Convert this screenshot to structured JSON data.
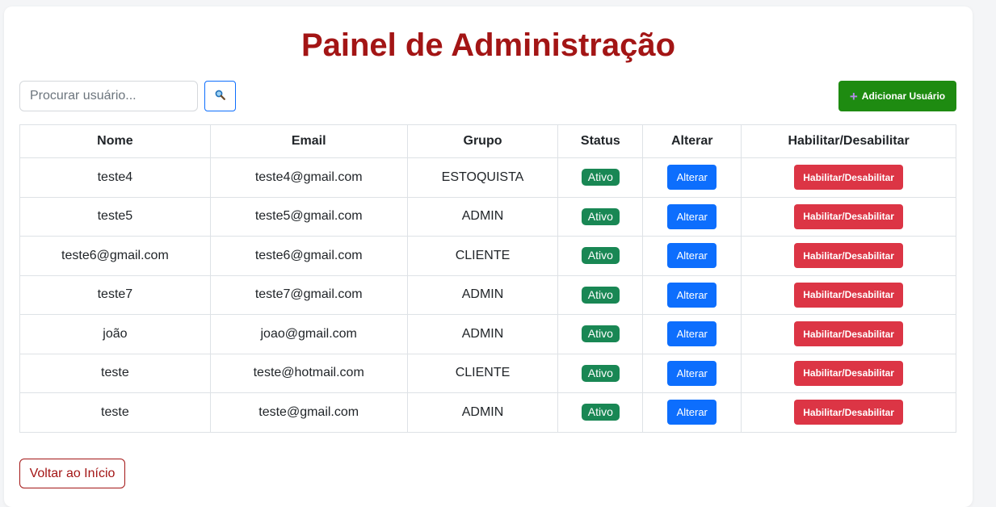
{
  "page": {
    "title": "Painel de Administração"
  },
  "toolbar": {
    "search_placeholder": "Procurar usuário...",
    "search_icon": "search-icon",
    "add_label": "Adicionar Usuário",
    "add_icon": "plus-icon"
  },
  "table": {
    "headers": [
      "Nome",
      "Email",
      "Grupo",
      "Status",
      "Alterar",
      "Habilitar/Desabilitar"
    ],
    "rows": [
      {
        "nome": "teste4",
        "email": "teste4@gmail.com",
        "grupo": "ESTOQUISTA",
        "status": "Ativo",
        "alterar": "Alterar",
        "toggle": "Habilitar/Desabilitar"
      },
      {
        "nome": "teste5",
        "email": "teste5@gmail.com",
        "grupo": "ADMIN",
        "status": "Ativo",
        "alterar": "Alterar",
        "toggle": "Habilitar/Desabilitar"
      },
      {
        "nome": "teste6@gmail.com",
        "email": "teste6@gmail.com",
        "grupo": "CLIENTE",
        "status": "Ativo",
        "alterar": "Alterar",
        "toggle": "Habilitar/Desabilitar"
      },
      {
        "nome": "teste7",
        "email": "teste7@gmail.com",
        "grupo": "ADMIN",
        "status": "Ativo",
        "alterar": "Alterar",
        "toggle": "Habilitar/Desabilitar"
      },
      {
        "nome": "joão",
        "email": "joao@gmail.com",
        "grupo": "ADMIN",
        "status": "Ativo",
        "alterar": "Alterar",
        "toggle": "Habilitar/Desabilitar"
      },
      {
        "nome": "teste",
        "email": "teste@hotmail.com",
        "grupo": "CLIENTE",
        "status": "Ativo",
        "alterar": "Alterar",
        "toggle": "Habilitar/Desabilitar"
      },
      {
        "nome": "teste",
        "email": "teste@gmail.com",
        "grupo": "ADMIN",
        "status": "Ativo",
        "alterar": "Alterar",
        "toggle": "Habilitar/Desabilitar"
      }
    ]
  },
  "footer": {
    "back_label": "Voltar ao Início"
  },
  "colors": {
    "title": "#a31515",
    "add_button": "#1e8b11",
    "status_badge": "#198754",
    "edit_button": "#0d6efd",
    "toggle_button": "#dc3545",
    "back_button": "#a31515"
  }
}
